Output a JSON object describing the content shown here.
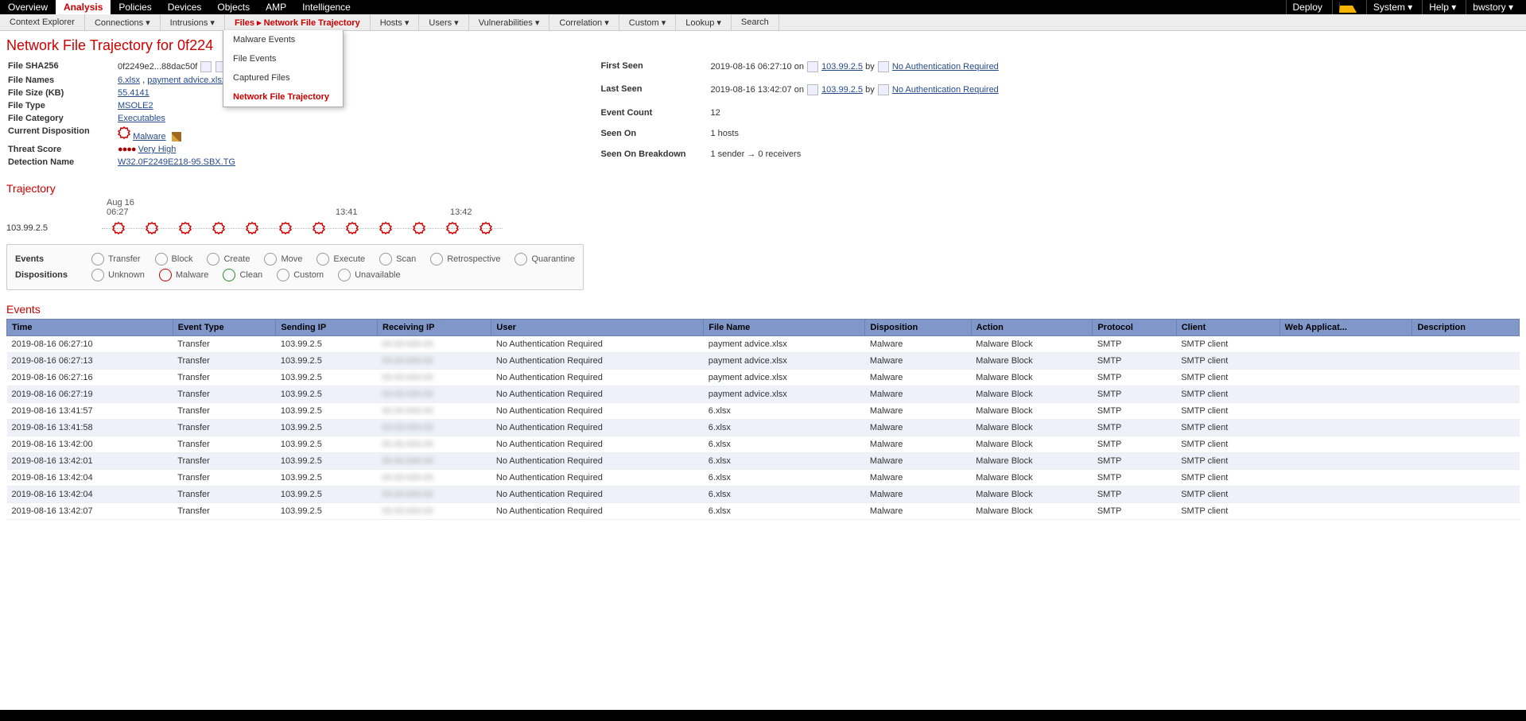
{
  "topnav": {
    "tabs": [
      "Overview",
      "Analysis",
      "Policies",
      "Devices",
      "Objects",
      "AMP",
      "Intelligence"
    ],
    "active": "Analysis",
    "right": {
      "deploy": "Deploy",
      "system": "System",
      "help": "Help",
      "user": "bwstory"
    }
  },
  "subnav": {
    "items": [
      "Context Explorer",
      "Connections",
      "Intrusions",
      "Files ▸ Network File Trajectory",
      "Hosts",
      "Users",
      "Vulnerabilities",
      "Correlation",
      "Custom",
      "Lookup",
      "Search"
    ],
    "activeIndex": 3,
    "dropdown": [
      "Malware Events",
      "File Events",
      "Captured Files",
      "Network File Trajectory"
    ],
    "dropdownSel": 3
  },
  "page_title": "Network File Trajectory for 0f224",
  "details_left": {
    "sha_label": "File SHA256",
    "sha": "0f2249e2...88dac50f",
    "names_label": "File Names",
    "names": [
      "6.xlsx",
      "payment advice.xlsx"
    ],
    "size_label": "File Size (KB)",
    "size": "55.4141",
    "type_label": "File Type",
    "type": "MSOLE2",
    "cat_label": "File Category",
    "cat": "Executables",
    "disp_label": "Current Disposition",
    "disp": "Malware",
    "score_label": "Threat Score",
    "score": "Very High",
    "det_label": "Detection Name",
    "det": "W32.0F2249E218-95.SBX.TG"
  },
  "details_right": {
    "first_label": "First Seen",
    "first_time": "2019-08-16 06:27:10 on",
    "first_ip": "103.99.2.5",
    "first_by": "by",
    "first_user": "No Authentication Required",
    "last_label": "Last Seen",
    "last_time": "2019-08-16 13:42:07 on",
    "last_ip": "103.99.2.5",
    "last_by": "by",
    "last_user": "No Authentication Required",
    "count_label": "Event Count",
    "count": "12",
    "seen_label": "Seen On",
    "seen": "1 hosts",
    "break_label": "Seen On Breakdown",
    "break": "1 sender → 0 receivers"
  },
  "trajectory": {
    "section": "Trajectory",
    "date": "Aug 16",
    "times": [
      "06:27",
      "",
      "",
      "",
      "13:41",
      "",
      "13:42"
    ],
    "ip": "103.99.2.5",
    "node_count": 12
  },
  "legend": {
    "events_label": "Events",
    "events": [
      "Transfer",
      "Block",
      "Create",
      "Move",
      "Execute",
      "Scan",
      "Retrospective",
      "Quarantine"
    ],
    "disp_label": "Dispositions",
    "disps": [
      "Unknown",
      "Malware",
      "Clean",
      "Custom",
      "Unavailable"
    ]
  },
  "events_section": "Events",
  "events_cols": [
    "Time",
    "Event Type",
    "Sending IP",
    "Receiving IP",
    "User",
    "File Name",
    "Disposition",
    "Action",
    "Protocol",
    "Client",
    "Web Applicat...",
    "Description"
  ],
  "events_rows": [
    {
      "time": "2019-08-16 06:27:10",
      "type": "Transfer",
      "sip": "103.99.2.5",
      "rip": "blurred",
      "user": "No Authentication Required",
      "file": "payment advice.xlsx",
      "disp": "Malware",
      "action": "Malware Block",
      "proto": "SMTP",
      "client": "SMTP client",
      "web": "",
      "desc": ""
    },
    {
      "time": "2019-08-16 06:27:13",
      "type": "Transfer",
      "sip": "103.99.2.5",
      "rip": "blurred",
      "user": "No Authentication Required",
      "file": "payment advice.xlsx",
      "disp": "Malware",
      "action": "Malware Block",
      "proto": "SMTP",
      "client": "SMTP client",
      "web": "",
      "desc": ""
    },
    {
      "time": "2019-08-16 06:27:16",
      "type": "Transfer",
      "sip": "103.99.2.5",
      "rip": "blurred",
      "user": "No Authentication Required",
      "file": "payment advice.xlsx",
      "disp": "Malware",
      "action": "Malware Block",
      "proto": "SMTP",
      "client": "SMTP client",
      "web": "",
      "desc": ""
    },
    {
      "time": "2019-08-16 06:27:19",
      "type": "Transfer",
      "sip": "103.99.2.5",
      "rip": "blurred",
      "user": "No Authentication Required",
      "file": "payment advice.xlsx",
      "disp": "Malware",
      "action": "Malware Block",
      "proto": "SMTP",
      "client": "SMTP client",
      "web": "",
      "desc": ""
    },
    {
      "time": "2019-08-16 13:41:57",
      "type": "Transfer",
      "sip": "103.99.2.5",
      "rip": "blurred",
      "user": "No Authentication Required",
      "file": "6.xlsx",
      "disp": "Malware",
      "action": "Malware Block",
      "proto": "SMTP",
      "client": "SMTP client",
      "web": "",
      "desc": ""
    },
    {
      "time": "2019-08-16 13:41:58",
      "type": "Transfer",
      "sip": "103.99.2.5",
      "rip": "blurred",
      "user": "No Authentication Required",
      "file": "6.xlsx",
      "disp": "Malware",
      "action": "Malware Block",
      "proto": "SMTP",
      "client": "SMTP client",
      "web": "",
      "desc": ""
    },
    {
      "time": "2019-08-16 13:42:00",
      "type": "Transfer",
      "sip": "103.99.2.5",
      "rip": "blurred",
      "user": "No Authentication Required",
      "file": "6.xlsx",
      "disp": "Malware",
      "action": "Malware Block",
      "proto": "SMTP",
      "client": "SMTP client",
      "web": "",
      "desc": ""
    },
    {
      "time": "2019-08-16 13:42:01",
      "type": "Transfer",
      "sip": "103.99.2.5",
      "rip": "blurred",
      "user": "No Authentication Required",
      "file": "6.xlsx",
      "disp": "Malware",
      "action": "Malware Block",
      "proto": "SMTP",
      "client": "SMTP client",
      "web": "",
      "desc": ""
    },
    {
      "time": "2019-08-16 13:42:04",
      "type": "Transfer",
      "sip": "103.99.2.5",
      "rip": "blurred",
      "user": "No Authentication Required",
      "file": "6.xlsx",
      "disp": "Malware",
      "action": "Malware Block",
      "proto": "SMTP",
      "client": "SMTP client",
      "web": "",
      "desc": ""
    },
    {
      "time": "2019-08-16 13:42:04",
      "type": "Transfer",
      "sip": "103.99.2.5",
      "rip": "blurred",
      "user": "No Authentication Required",
      "file": "6.xlsx",
      "disp": "Malware",
      "action": "Malware Block",
      "proto": "SMTP",
      "client": "SMTP client",
      "web": "",
      "desc": ""
    },
    {
      "time": "2019-08-16 13:42:07",
      "type": "Transfer",
      "sip": "103.99.2.5",
      "rip": "blurred",
      "user": "No Authentication Required",
      "file": "6.xlsx",
      "disp": "Malware",
      "action": "Malware Block",
      "proto": "SMTP",
      "client": "SMTP client",
      "web": "",
      "desc": ""
    }
  ]
}
